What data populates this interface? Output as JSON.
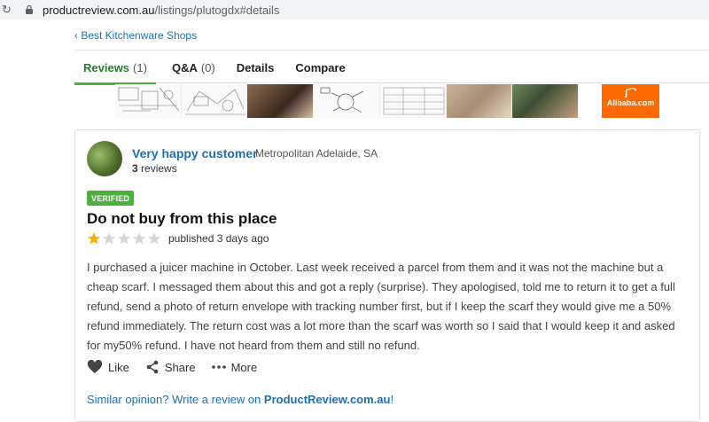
{
  "browser": {
    "url_host": "productreview.com.au",
    "url_path": "/listings/plutogdx#details"
  },
  "breadcrumb": {
    "label": "‹ Best Kitchenware Shops"
  },
  "tabs": [
    {
      "label": "Reviews",
      "count": "(1)",
      "active": true
    },
    {
      "label": "Q&A",
      "count": "(0)",
      "active": false
    },
    {
      "label": "Details",
      "count": "",
      "active": false
    },
    {
      "label": "Compare",
      "count": "",
      "active": false
    }
  ],
  "ad": {
    "brand": "Alibaba.com"
  },
  "review": {
    "author": "Very happy customer",
    "location": "Metropolitan Adelaide, SA",
    "review_count": "3",
    "review_count_suffix": " reviews",
    "badge": "VERIFIED",
    "title": "Do not buy from this place",
    "rating": 1,
    "rating_max": 5,
    "published": "published 3 days ago",
    "body": "I purchased a juicer machine in October. Last week received a parcel from them and it was not the machine but a cheap scarf. I messaged them about this and got a reply (surprise). They apologised, told me to return it to get a full refund, send a photo of return envelope with tracking number first, but if I keep the scarf they would give me a 50% refund immediately. The return cost was a lot more than the scarf was worth so I said that I would keep it and asked for my50% refund. I have not heard from them and still no refund."
  },
  "actions": {
    "like": "Like",
    "share": "Share",
    "more": "More"
  },
  "similar": {
    "prefix": "Similar opinion? Write a review on ",
    "site": "ProductReview.com.au",
    "suffix": "!"
  },
  "colors": {
    "link": "#1f6fb3",
    "active_tab": "#2b7a2b",
    "accent_green": "#4caf3f",
    "star_filled": "#f5b301",
    "star_empty": "#d5d5d5",
    "ad_orange": "#ff6a00"
  }
}
